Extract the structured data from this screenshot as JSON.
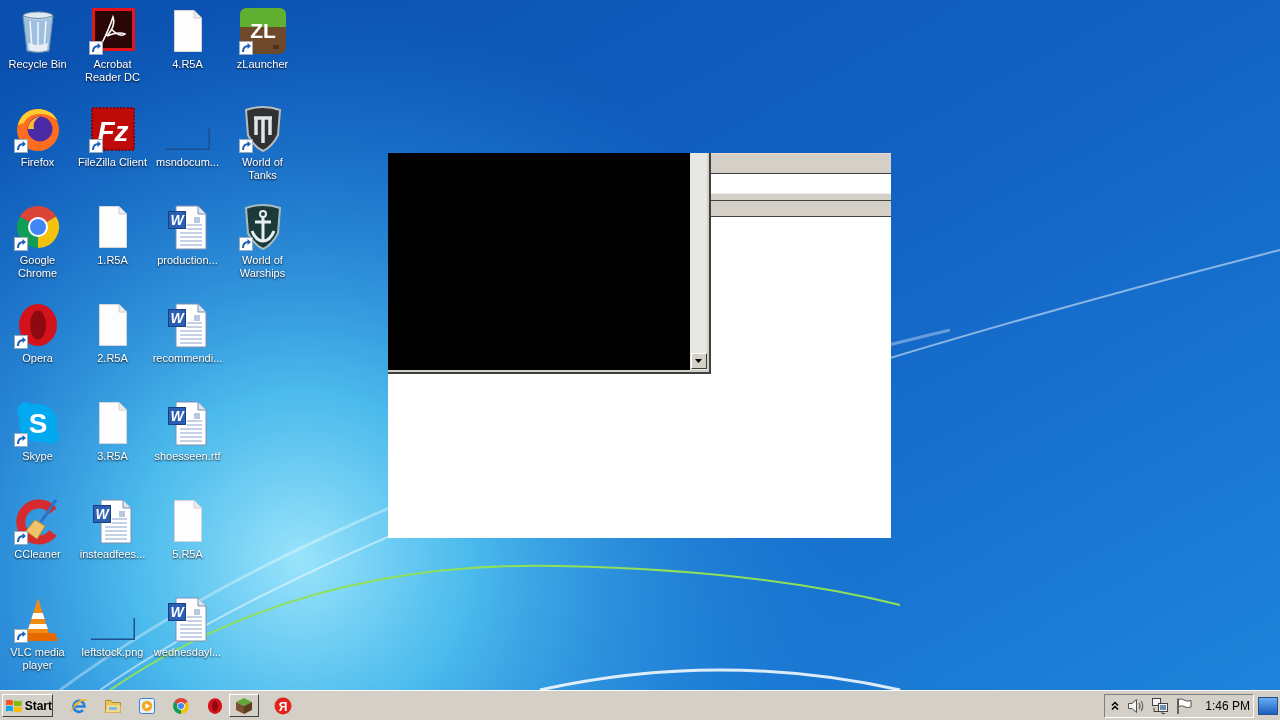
{
  "desktop": {
    "icons": [
      {
        "label": "Recycle Bin",
        "kind": "recycle-bin",
        "shortcut": false
      },
      {
        "label": "Firefox",
        "kind": "firefox",
        "shortcut": true
      },
      {
        "label": "Google Chrome",
        "kind": "chrome",
        "shortcut": true
      },
      {
        "label": "Opera",
        "kind": "opera",
        "shortcut": true
      },
      {
        "label": "Skype",
        "kind": "skype",
        "glyph": "S",
        "shortcut": true
      },
      {
        "label": "CCleaner",
        "kind": "ccleaner",
        "shortcut": true
      },
      {
        "label": "VLC media player",
        "kind": "vlc",
        "shortcut": true
      },
      {
        "label": "Acrobat Reader DC",
        "kind": "acrobat",
        "shortcut": true
      },
      {
        "label": "FileZilla Client",
        "kind": "filezilla",
        "glyph": "Fz",
        "shortcut": true
      },
      {
        "label": "1.R5A",
        "kind": "blank-file",
        "shortcut": false
      },
      {
        "label": "2.R5A",
        "kind": "blank-file",
        "shortcut": false
      },
      {
        "label": "3.R5A",
        "kind": "blank-file",
        "shortcut": false
      },
      {
        "label": "insteadfees...",
        "kind": "word",
        "glyph": "W",
        "shortcut": false
      },
      {
        "label": "leftstock.png",
        "kind": "thumbnail",
        "shortcut": false
      },
      {
        "label": "4.R5A",
        "kind": "blank-file",
        "shortcut": false
      },
      {
        "label": "msndocum...",
        "kind": "thumbnail",
        "shortcut": false
      },
      {
        "label": "production...",
        "kind": "word",
        "glyph": "W",
        "shortcut": false
      },
      {
        "label": "recommendi...",
        "kind": "word",
        "glyph": "W",
        "shortcut": false
      },
      {
        "label": "shoesseen.rtf",
        "kind": "word",
        "glyph": "W",
        "shortcut": false
      },
      {
        "label": "5.R5A",
        "kind": "blank-file",
        "shortcut": false
      },
      {
        "label": "wednesdayl...",
        "kind": "word",
        "glyph": "W",
        "shortcut": false
      },
      {
        "label": "zLauncher",
        "kind": "zlauncher",
        "glyph": "ZL",
        "shortcut": true
      },
      {
        "label": "World of Tanks",
        "kind": "tanks",
        "shortcut": true
      },
      {
        "label": "World of Warships",
        "kind": "warships",
        "shortcut": true
      }
    ]
  },
  "taskbar": {
    "start_label": "Start",
    "items": [
      {
        "kind": "browser-e",
        "running": false
      },
      {
        "kind": "folder",
        "running": false
      },
      {
        "kind": "media-player",
        "running": false
      },
      {
        "kind": "chrome",
        "running": false
      },
      {
        "kind": "opera",
        "running": false
      },
      {
        "kind": "grass-block",
        "running": true
      },
      {
        "kind": "yandex",
        "glyph": "Я",
        "running": false
      }
    ],
    "clock": "1:46 PM"
  }
}
